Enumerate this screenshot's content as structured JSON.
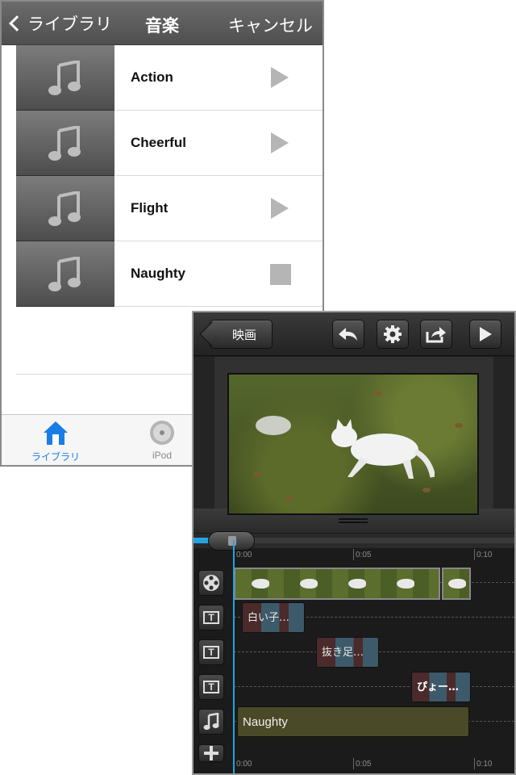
{
  "library": {
    "nav": {
      "back_label": "ライブラリ",
      "title": "音楽",
      "cancel_label": "キャンセル"
    },
    "tracks": [
      {
        "name": "Action",
        "state": "play"
      },
      {
        "name": "Cheerful",
        "state": "play"
      },
      {
        "name": "Flight",
        "state": "play"
      },
      {
        "name": "Naughty",
        "state": "stop"
      }
    ],
    "tabs": [
      {
        "label": "ライブラリ",
        "icon": "house-icon",
        "selected": true
      },
      {
        "label": "iPod",
        "icon": "disc-icon",
        "selected": false
      }
    ],
    "accent_color": "#1a7ce6"
  },
  "editor": {
    "toolbar": {
      "back_label": "映画",
      "icons": [
        "undo-icon",
        "gear-icon",
        "share-icon",
        "play-icon"
      ]
    },
    "ruler_top": [
      "0:00",
      "0:05",
      "0:10"
    ],
    "ruler_bottom": [
      "0:00",
      "0:05",
      "0:10"
    ],
    "text_clips": [
      {
        "label": "白い子…"
      },
      {
        "label": "抜き足…"
      },
      {
        "label": "ぴょー…"
      }
    ],
    "music_clip": {
      "label": "Naughty"
    },
    "playhead_color": "#23a3e0"
  }
}
